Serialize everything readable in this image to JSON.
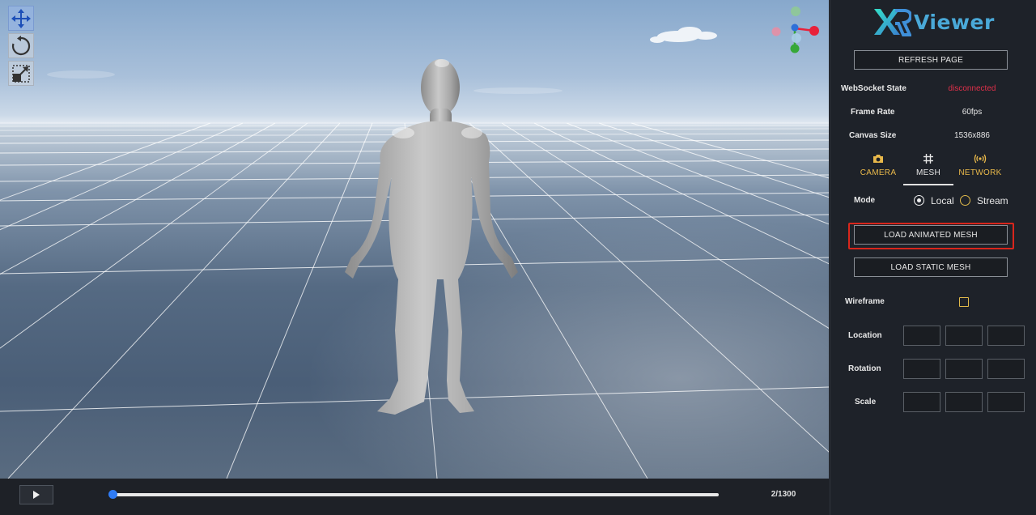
{
  "app": {
    "logo_mark": "XR",
    "logo_text": "Viewer"
  },
  "toolbar": {
    "tools": [
      "move-tool",
      "rotate-tool",
      "scale-tool"
    ]
  },
  "gizmo": {
    "axes": {
      "x": "#e8213a",
      "y": "#36a838",
      "z": "#2f6fd8"
    }
  },
  "timeline": {
    "current_frame": 2,
    "total_frames": 1300,
    "counter": "2/1300"
  },
  "panel": {
    "refresh_label": "REFRESH PAGE",
    "stats": [
      {
        "label": "WebSocket State",
        "value": "disconnected",
        "color": "#e0304a"
      },
      {
        "label": "Frame Rate",
        "value": "60fps",
        "color": "#e6e6e6"
      },
      {
        "label": "Canvas Size",
        "value": "1536x886",
        "color": "#e6e6e6"
      }
    ],
    "tabs": [
      {
        "label": "CAMERA",
        "icon": "camera-icon",
        "color": "#e8b84a",
        "active": false
      },
      {
        "label": "MESH",
        "icon": "grid-icon",
        "color": "#e6e6e6",
        "active": true
      },
      {
        "label": "NETWORK",
        "icon": "broadcast-icon",
        "color": "#e8b84a",
        "active": false
      }
    ],
    "mode": {
      "label": "Mode",
      "options": [
        "Local",
        "Stream"
      ],
      "selected": "Local"
    },
    "load_animated_label": "LOAD ANIMATED MESH",
    "load_static_label": "LOAD STATIC MESH",
    "wireframe": {
      "label": "Wireframe",
      "checked": false
    },
    "transform": [
      {
        "label": "Location",
        "values": [
          "",
          "",
          ""
        ]
      },
      {
        "label": "Rotation",
        "values": [
          "",
          "",
          ""
        ]
      },
      {
        "label": "Scale",
        "values": [
          "",
          "",
          ""
        ]
      }
    ],
    "highlight_color": "#d9261c"
  }
}
